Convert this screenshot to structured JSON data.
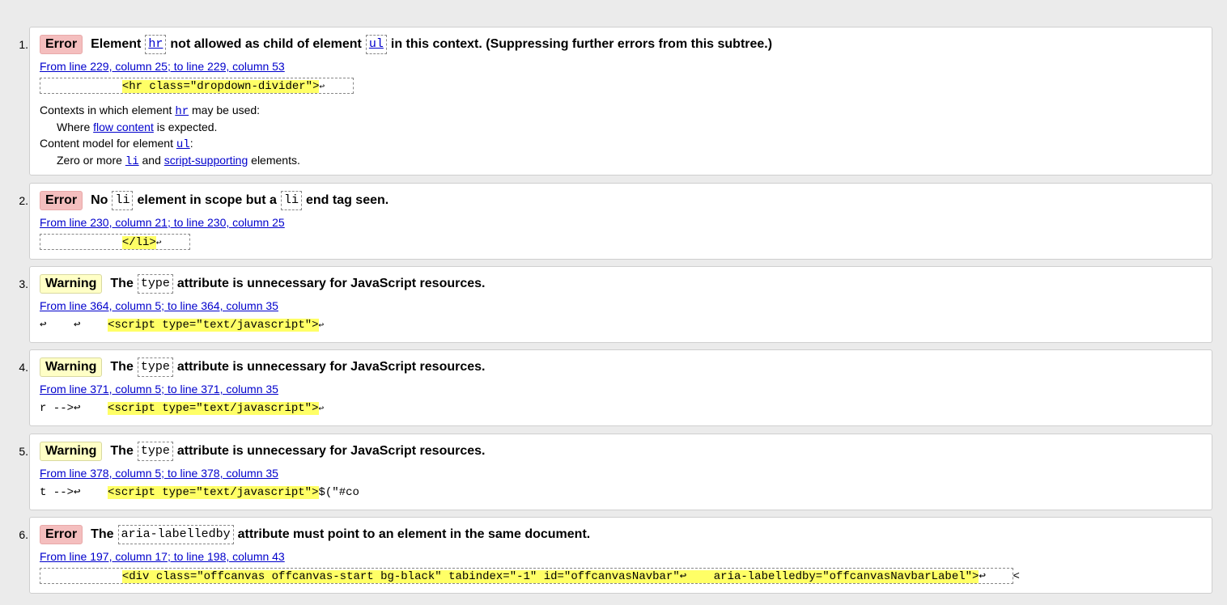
{
  "messages": [
    {
      "number": "1.",
      "type_label": "Error",
      "parts": [
        "Element",
        "hr",
        "not allowed as child of element",
        "ul",
        "in this context. (Suppressing further errors from this subtree.)"
      ],
      "location": "From line 229, column 25; to line 229, column 53",
      "extract_pre": "            ",
      "extract_hl": "<hr class=\"dropdown-divider\">",
      "extract_post": "↩",
      "ctx1_pre": "Contexts in which element ",
      "ctx1_code": "hr",
      "ctx1_post": " may be used:",
      "ctx2_pre": "Where ",
      "ctx2_link": "flow content",
      "ctx2_post": " is expected.",
      "ctx3_pre": "Content model for element ",
      "ctx3_code": "ul",
      "ctx3_post": ":",
      "ctx4_pre": "Zero or more ",
      "ctx4_code": "li",
      "ctx4_mid": " and ",
      "ctx4_link": "script-supporting",
      "ctx4_post": " elements."
    },
    {
      "number": "2.",
      "type_label": "Error",
      "parts": [
        "No",
        "li",
        "element in scope but a",
        "li",
        "end tag seen."
      ],
      "location": "From line 230, column 21; to line 230, column 25",
      "extract_pre": "            ",
      "extract_hl": "</li>",
      "extract_post": "↩       "
    },
    {
      "number": "3.",
      "type_label": "Warning",
      "parts": [
        "The",
        "type",
        "attribute is unnecessary for JavaScript resources."
      ],
      "location": "From line 364, column 5; to line 364, column 35",
      "extract_pre": "↩    ↩    ",
      "extract_hl": "<script type=\"text/javascript\">",
      "extract_post": "↩"
    },
    {
      "number": "4.",
      "type_label": "Warning",
      "parts": [
        "The",
        "type",
        "attribute is unnecessary for JavaScript resources."
      ],
      "location": "From line 371, column 5; to line 371, column 35",
      "extract_pre": "r -->↩    ",
      "extract_hl": "<script type=\"text/javascript\">",
      "extract_post": "↩"
    },
    {
      "number": "5.",
      "type_label": "Warning",
      "parts": [
        "The",
        "type",
        "attribute is unnecessary for JavaScript resources."
      ],
      "location": "From line 378, column 5; to line 378, column 35",
      "extract_pre": "t -->↩    ",
      "extract_hl": "<script type=\"text/javascript\">",
      "extract_post": "$(\"#co"
    },
    {
      "number": "6.",
      "type_label": "Error",
      "parts": [
        "The",
        "aria-labelledby",
        "attribute must point to an element in the same document."
      ],
      "location": "From line 197, column 17; to line 198, column 43",
      "extract_pre": "            ",
      "extract_hl": "<div class=\"offcanvas offcanvas-start bg-black\" tabindex=\"-1\" id=\"offcanvasNavbar\"↩    aria-labelledby=\"offcanvasNavbarLabel\">",
      "extract_post": "↩    <"
    }
  ],
  "colors": {
    "error_badge": "#f4bebe",
    "warning_badge": "#ffffc6",
    "highlight": "#ffff66",
    "link": "#0000cc"
  }
}
